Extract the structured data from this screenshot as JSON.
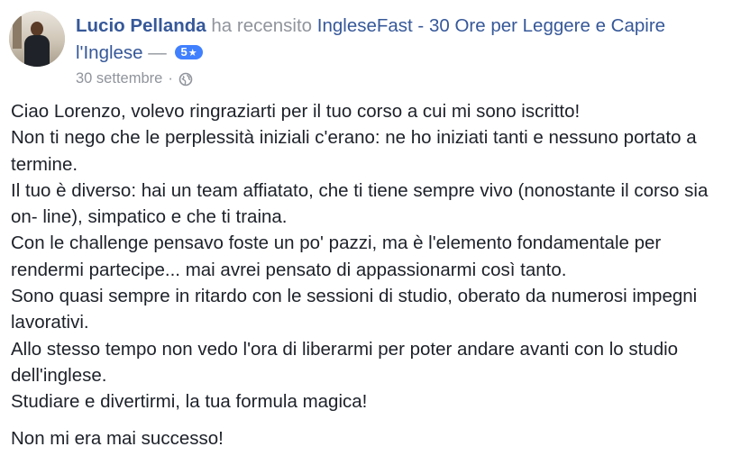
{
  "review": {
    "author": "Lucio Pellanda",
    "action_text": "ha recensito",
    "page_name": "IngleseFast - 30 Ore per Leggere e Capire l'Inglese",
    "separator": "—",
    "rating": "5",
    "rating_star": "★",
    "date": "30 settembre",
    "dot": "·",
    "privacy_icon": "globe-icon"
  },
  "body": {
    "paragraphs": [
      "Ciao Lorenzo, volevo ringraziarti per il tuo corso a cui mi sono iscritto!",
      "Non ti nego che le perplessità iniziali c'erano: ne ho iniziati tanti e nessuno portato a termine.",
      "Il tuo è diverso: hai un team affiatato, che ti tiene sempre vivo (nonostante il corso sia on- line), simpatico e che ti traina.",
      "Con le challenge pensavo foste un po' pazzi, ma è l'elemento fondamentale per rendermi partecipe... mai avrei pensato di appassionarmi così tanto.",
      "Sono quasi sempre in ritardo con le sessioni di studio, oberato da numerosi impegni lavorativi.",
      "Allo stesso tempo non vedo l'ora di liberarmi per poter andare avanti con lo studio dell'inglese.",
      "Studiare e divertirmi, la tua formula magica!"
    ],
    "closing": "Non mi era mai successo!"
  },
  "colors": {
    "link": "#365899",
    "muted": "#90949c",
    "text": "#1d2129",
    "badge": "#4080ff"
  }
}
